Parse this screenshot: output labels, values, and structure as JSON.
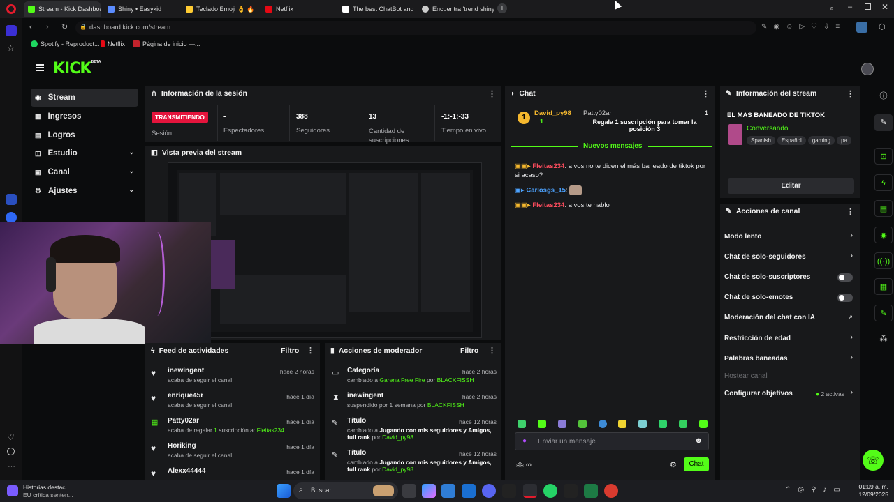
{
  "browser": {
    "tabs": [
      {
        "label": "Stream - Kick Dashboard",
        "color": "#53fc18"
      },
      {
        "label": "Shiny • Easykid",
        "color": "#5b8cff"
      },
      {
        "label": "Teclado Emoji 👌 🔥",
        "color": "#ffcc33"
      },
      {
        "label": "Netflix",
        "color": "#e50914"
      },
      {
        "label": "The best ChatBot and Wid",
        "color": "#ffffff"
      },
      {
        "label": "Encuentra 'trend shiny co",
        "color": "#cccccc"
      }
    ],
    "url": "dashboard.kick.com/stream",
    "bookmarks": [
      "Spotify - Reproduct...",
      "Netflix",
      "Página de inicio —..."
    ]
  },
  "sidebar": {
    "items": [
      {
        "label": "Stream",
        "selected": true
      },
      {
        "label": "Ingresos"
      },
      {
        "label": "Logros"
      },
      {
        "label": "Estudio"
      },
      {
        "label": "Canal"
      },
      {
        "label": "Ajustes"
      }
    ]
  },
  "logo": {
    "text": "KICK",
    "beta": "BETA"
  },
  "session": {
    "title": "Información de la sesión",
    "live_badge": "TRANSMITIENDO",
    "stats": [
      {
        "value": "-",
        "label": "Sesión"
      },
      {
        "value": "-",
        "label": "Espectadores"
      },
      {
        "value": "388",
        "label": "Seguidores"
      },
      {
        "value": "13",
        "label": "Cantidad de suscripciones"
      },
      {
        "value": "-1:-1:-33",
        "label": "Tiempo en vivo"
      }
    ]
  },
  "preview": {
    "title": "Vista previa del stream"
  },
  "feed": {
    "title": "Feed de actividades",
    "filter": "Filtro",
    "items": [
      {
        "name": "inewingent",
        "desc": "acaba de seguir el canal",
        "time": "hace 2 horas"
      },
      {
        "name": "enrique45r",
        "desc": "acaba de seguir el canal",
        "time": "hace 1 día"
      },
      {
        "name": "Patty02ar",
        "desc_a": "acaba de regalar",
        "count": "1",
        "desc_b": "suscripción a:",
        "target": "Fleitas234",
        "time": "hace 1 día"
      },
      {
        "name": "Horiking",
        "desc": "acaba de seguir el canal",
        "time": "hace 1 día"
      },
      {
        "name": "Alexx44444",
        "desc": "",
        "time": "hace 1 día"
      }
    ]
  },
  "mod": {
    "title": "Acciones de moderador",
    "filter": "Filtro",
    "items": [
      {
        "title": "Categoría",
        "line": "cambiado a",
        "value": "Garena Free Fire",
        "por": "por",
        "who": "BLACKFISSH",
        "time": "hace 2 horas"
      },
      {
        "title": "inewingent",
        "line": "suspendido por 1 semana por",
        "value": "",
        "por": "",
        "who": "BLACKFISSH",
        "time": "hace 2 horas"
      },
      {
        "title": "Título",
        "line": "cambiado a",
        "value": "Jugando con mis seguidores y Amigos,",
        "cont": "full rank",
        "por": "por",
        "who": "David_py98",
        "time": "hace 12 horas"
      },
      {
        "title": "Título",
        "line": "cambiado a",
        "value": "Jugando con mis seguidores y Amigos,",
        "cont": "full rank",
        "por": "por",
        "who": "David_py98",
        "time": "hace 12 horas"
      }
    ]
  },
  "chat": {
    "title": "Chat",
    "pinned": {
      "user": "David_py98",
      "level": "1",
      "gifter": "Patty02ar",
      "count": "1",
      "text": "Regala 1 suscripción para tomar la posición 3"
    },
    "new_messages": "Nuevos mensajes",
    "messages": [
      {
        "user": "Fleitas234",
        "color": "#ff4d5e",
        "text": ": a vos no te dicen el más baneado de tiktok por si acaso?"
      },
      {
        "user": "Carlosgs_15",
        "color": "#4da3ff",
        "text": ":"
      },
      {
        "user": "Fleitas234",
        "color": "#ff4d5e",
        "text": ": a vos te hablo"
      }
    ],
    "placeholder": "Enviar un mensaje",
    "send": "Chat"
  },
  "stream_info": {
    "title": "Información del stream",
    "stream_title": "EL MAS BANEADO DE TIKTOK",
    "category": "Conversando",
    "tags": [
      "Spanish",
      "Español",
      "gaming",
      "pa"
    ],
    "edit": "Editar"
  },
  "channel_actions": {
    "title": "Acciones de canal",
    "items": [
      {
        "label": "Modo lento",
        "kind": "chevron"
      },
      {
        "label": "Chat de solo-seguidores",
        "kind": "chevron"
      },
      {
        "label": "Chat de solo-suscriptores",
        "kind": "toggle"
      },
      {
        "label": "Chat de solo-emotes",
        "kind": "toggle"
      },
      {
        "label": "Moderación del chat con IA",
        "kind": "external"
      },
      {
        "label": "Restricción de edad",
        "kind": "chevron"
      },
      {
        "label": "Palabras baneadas",
        "kind": "chevron"
      },
      {
        "label": "Hostear canal",
        "kind": "disabled"
      },
      {
        "label": "Configurar objetivos",
        "kind": "chevron",
        "badge": "2 activas"
      }
    ]
  },
  "taskbar": {
    "news_title": "Historias destac...",
    "news_sub": "EU crítica senten...",
    "search": "Buscar",
    "time": "01:09 a. m.",
    "date": "12/09/2025"
  },
  "colors": {
    "accent": "#53fc18",
    "live": "#e4143c",
    "panel": "#18191b",
    "bg": "#0b0c0d"
  }
}
